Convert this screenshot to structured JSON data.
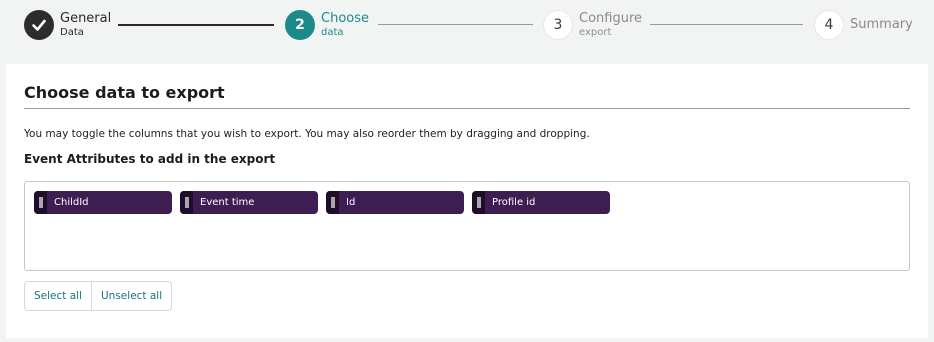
{
  "stepper": {
    "steps": [
      {
        "number": "",
        "title": "General",
        "sub": "Data",
        "state": "done",
        "icon": "check-icon"
      },
      {
        "number": "2",
        "title": "Choose",
        "sub": "data",
        "state": "active"
      },
      {
        "number": "3",
        "title": "Configure",
        "sub": "export",
        "state": "todo"
      },
      {
        "number": "4",
        "title": "Summary",
        "sub": "",
        "state": "todo"
      }
    ]
  },
  "card": {
    "title": "Choose data to export",
    "description": "You may toggle the columns that you wish to export. You may also reorder them by dragging and dropping.",
    "subtitle": "Event Attributes to add in the export",
    "chips": [
      "ChildId",
      "Event time",
      "Id",
      "Profile id"
    ],
    "select_all_label": "Select all",
    "unselect_all_label": "Unselect all"
  },
  "colors": {
    "accent": "#1b8a8a",
    "chip": "#3e1d53",
    "link": "#1b6f80"
  }
}
